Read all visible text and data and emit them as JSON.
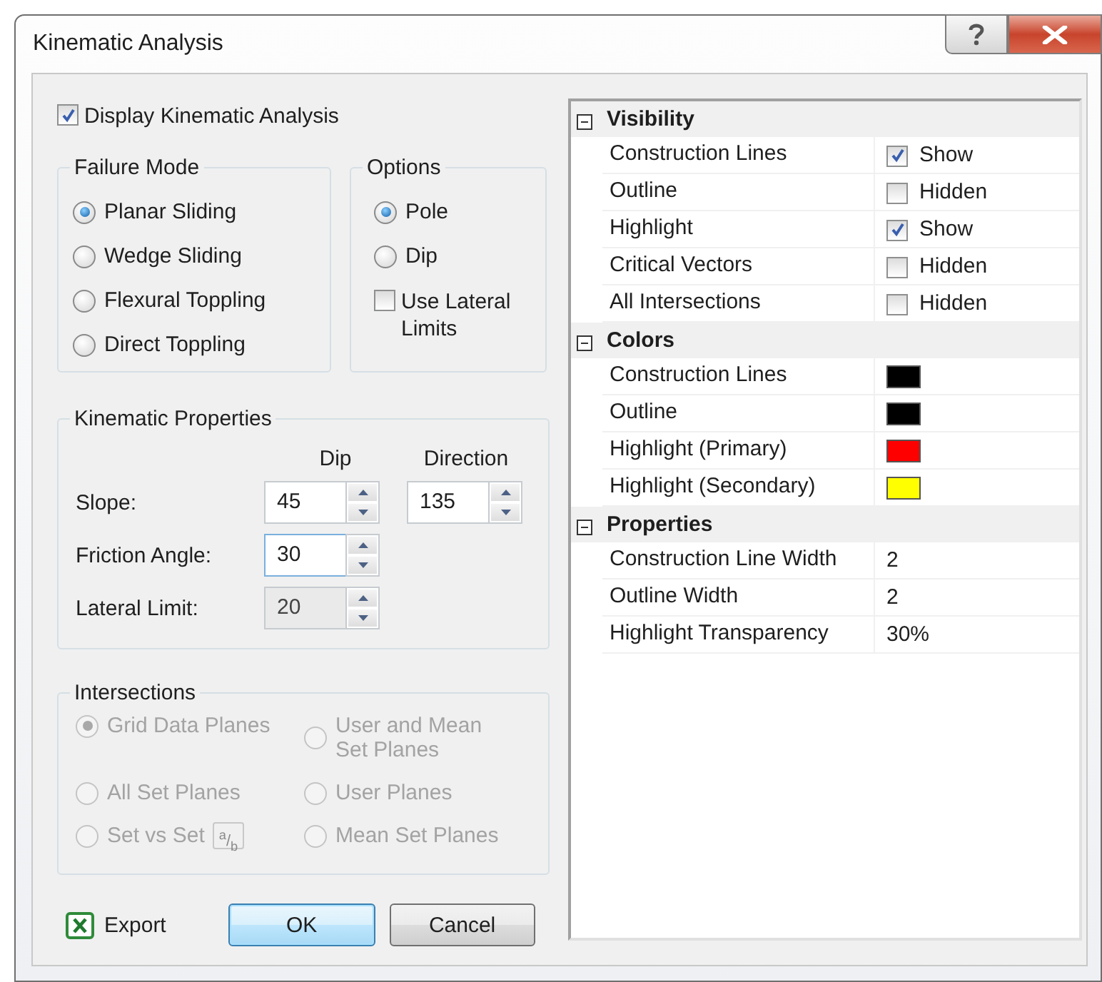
{
  "window": {
    "title": "Kinematic Analysis"
  },
  "display_kinematic": {
    "label": "Display Kinematic Analysis",
    "checked": true
  },
  "failure_mode": {
    "title": "Failure Mode",
    "options": [
      {
        "label": "Planar Sliding",
        "selected": true
      },
      {
        "label": "Wedge Sliding",
        "selected": false
      },
      {
        "label": "Flexural Toppling",
        "selected": false
      },
      {
        "label": "Direct Toppling",
        "selected": false
      }
    ]
  },
  "options": {
    "title": "Options",
    "options": [
      {
        "label": "Pole",
        "selected": true
      },
      {
        "label": "Dip",
        "selected": false
      }
    ],
    "lateral_limits": {
      "label": "Use Lateral Limits",
      "checked": false
    }
  },
  "kinematic_properties": {
    "title": "Kinematic Properties",
    "columns": [
      "Dip",
      "Direction"
    ],
    "rows": [
      {
        "label": "Slope:",
        "values": [
          "45",
          "135"
        ],
        "focused": false,
        "disabled": false
      },
      {
        "label": "Friction Angle:",
        "values": [
          "30"
        ],
        "focused": true,
        "disabled": false
      },
      {
        "label": "Lateral Limit:",
        "values": [
          "20"
        ],
        "focused": false,
        "disabled": true
      }
    ]
  },
  "intersections": {
    "title": "Intersections",
    "disabled": true,
    "options": [
      {
        "label": "Grid Data Planes",
        "selected": true
      },
      {
        "label": "User and Mean Set Planes",
        "selected": false
      },
      {
        "label": "All Set Planes",
        "selected": false
      },
      {
        "label": "User Planes",
        "selected": false
      },
      {
        "label": "Set vs Set",
        "selected": false,
        "fraction_button": "$^{a}$/$_{b}$"
      },
      {
        "label": "Mean Set Planes",
        "selected": false
      }
    ]
  },
  "export": {
    "label": "Export"
  },
  "buttons": [
    {
      "label": "OK",
      "default": true
    },
    {
      "label": "Cancel",
      "default": false
    }
  ],
  "property_grid": {
    "sections": [
      {
        "title": "Visibility",
        "expanded": true,
        "rows": [
          {
            "kind": "check",
            "name": "Construction Lines",
            "checked": true,
            "value": "Show"
          },
          {
            "kind": "check",
            "name": "Outline",
            "checked": false,
            "value": "Hidden"
          },
          {
            "kind": "check",
            "name": "Highlight",
            "checked": true,
            "value": "Show"
          },
          {
            "kind": "check",
            "name": "Critical Vectors",
            "checked": false,
            "value": "Hidden"
          },
          {
            "kind": "check",
            "name": "All Intersections",
            "checked": false,
            "value": "Hidden"
          }
        ]
      },
      {
        "title": "Colors",
        "expanded": true,
        "rows": [
          {
            "kind": "color",
            "name": "Construction Lines",
            "color": "#000000"
          },
          {
            "kind": "color",
            "name": "Outline",
            "color": "#000000"
          },
          {
            "kind": "color",
            "name": "Highlight (Primary)",
            "color": "#ff0000"
          },
          {
            "kind": "color",
            "name": "Highlight (Secondary)",
            "color": "#ffff00"
          }
        ]
      },
      {
        "title": "Properties",
        "expanded": true,
        "rows": [
          {
            "kind": "text",
            "name": "Construction Line Width",
            "value": "2"
          },
          {
            "kind": "text",
            "name": "Outline Width",
            "value": "2"
          },
          {
            "kind": "text",
            "name": "Highlight Transparency",
            "value": "30%"
          }
        ]
      }
    ]
  }
}
